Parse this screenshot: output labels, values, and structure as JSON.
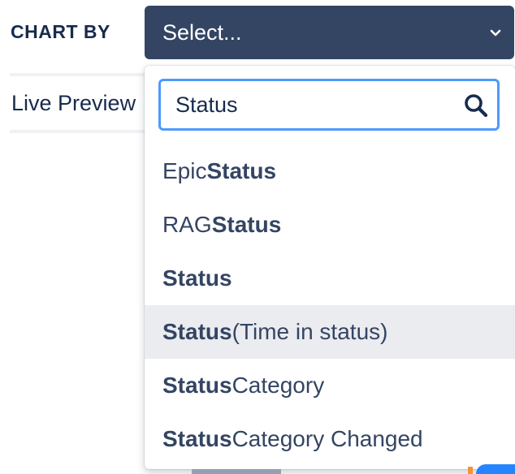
{
  "chart_by_label": "CHART BY",
  "select": {
    "value": "Select..."
  },
  "live_preview_label": "Live Preview",
  "search": {
    "value": "Status"
  },
  "options": [
    {
      "pre": "Epic ",
      "match": "Status",
      "post": ""
    },
    {
      "pre": "RAG ",
      "match": "Status",
      "post": ""
    },
    {
      "pre": "",
      "match": "Status",
      "post": ""
    },
    {
      "pre": "",
      "match": "Status",
      "post": " (Time in status)"
    },
    {
      "pre": "",
      "match": "Status",
      "post": " Category"
    },
    {
      "pre": "",
      "match": "Status",
      "post": " Category Changed"
    }
  ],
  "highlighted_option_index": 3,
  "colors": {
    "select_bg": "#344563",
    "focus_border": "#4c9aff",
    "highlight_bg": "#ebecf0",
    "text": "#172b4d"
  },
  "icons": {
    "select_chevron": "chevron-down-icon",
    "search": "search-icon"
  }
}
